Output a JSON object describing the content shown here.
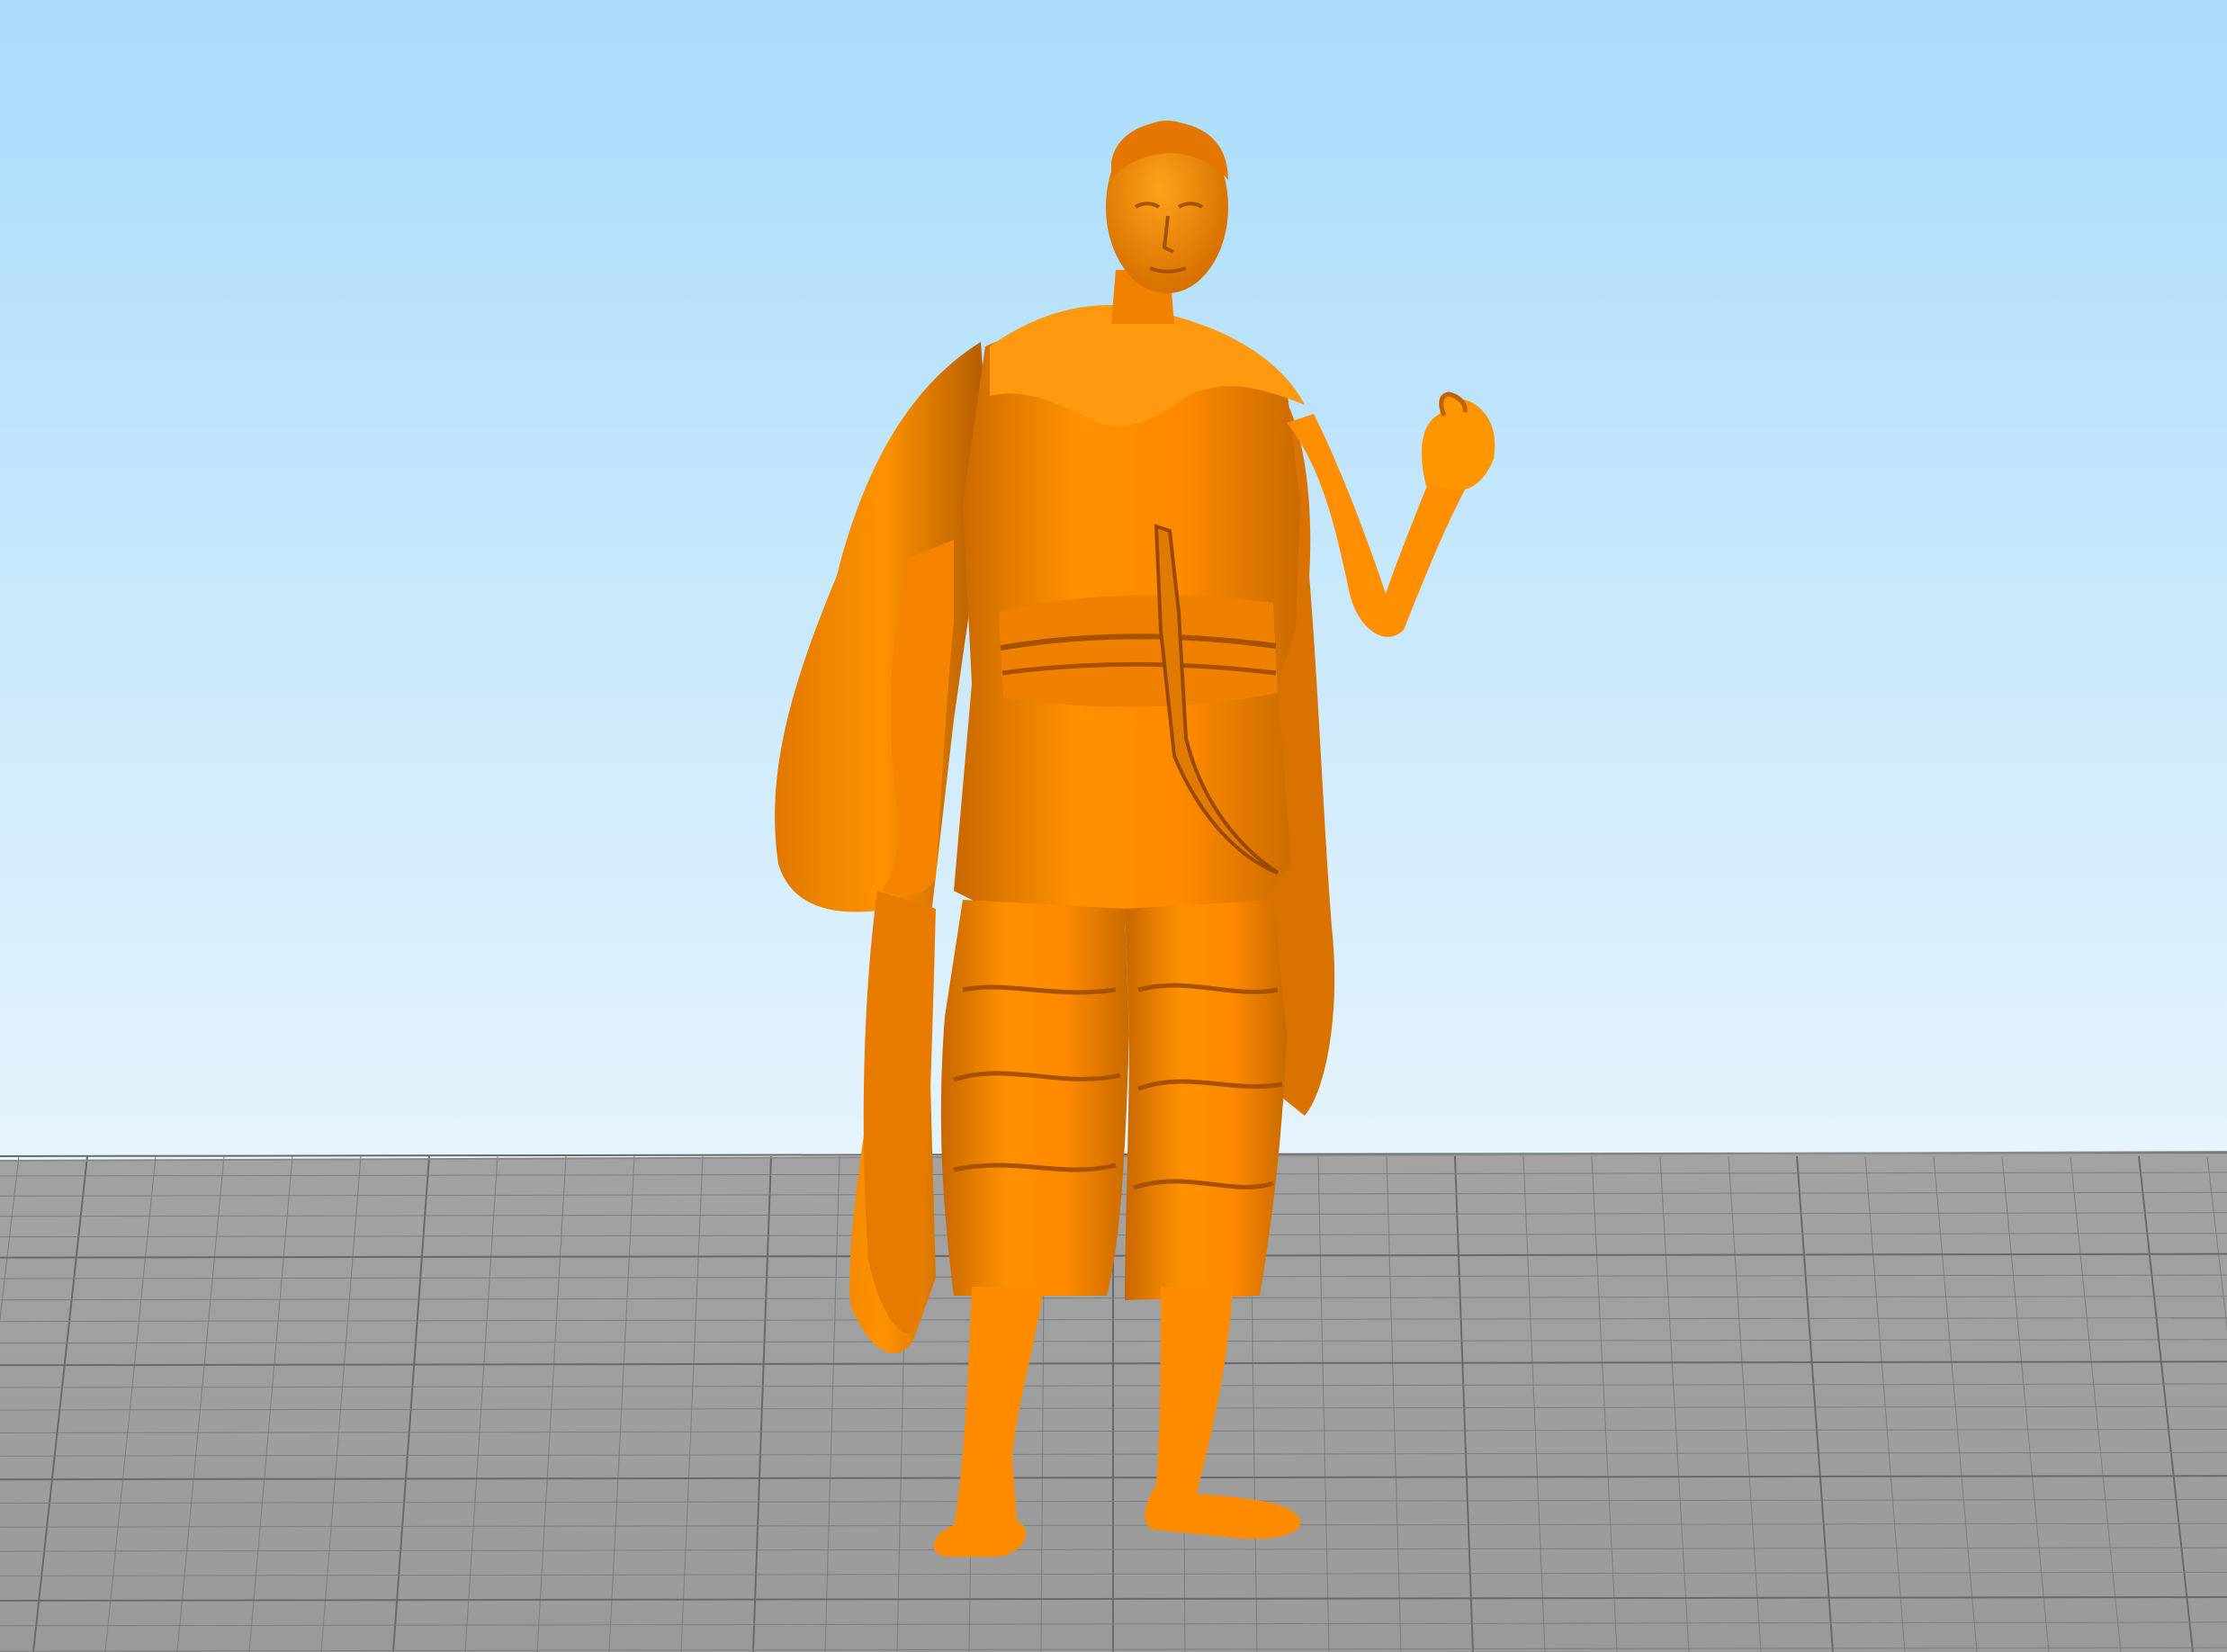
{
  "viewport": {
    "sky_top_color": "#a9dcfb",
    "sky_bottom_color": "#e6f4fd",
    "floor_color": "#9f9f9f",
    "floor_grid_color": "#7d7d7d",
    "floor_major_grid_color": "#6a6a6a"
  },
  "model": {
    "name": "standing-robed-figure",
    "base_color": "#ff8a00",
    "highlight_color": "#ffa21a",
    "shadow_color": "#b85a00",
    "deep_shadow_color": "#8a4200"
  }
}
